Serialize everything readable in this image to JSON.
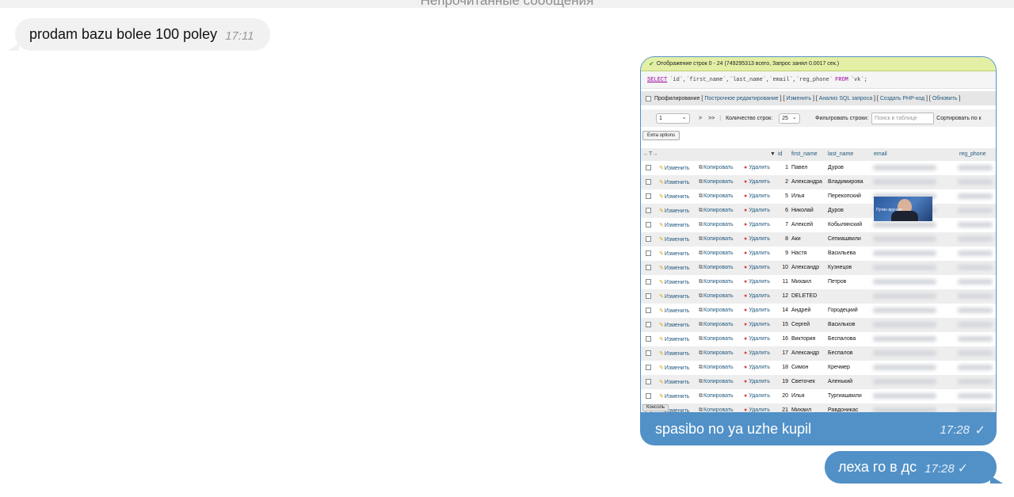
{
  "unread_bar": {
    "label": "Непрочитанные сообщения"
  },
  "messages": [
    {
      "text": "prodam bazu bolee 100 poley",
      "time": "17:11"
    },
    {
      "caption": "spasibo no ya uzhe kupil",
      "time": "17:28",
      "check": "✓"
    },
    {
      "text": "леха го в дс",
      "time": "17:28",
      "check": "✓"
    }
  ],
  "screenshot": {
    "success": "Отображение строк 0 - 24 (749295313 всего, Запрос занял 0.0017 сек.)",
    "sql_select": "SELECT",
    "sql_columns": "`id`,`first_name`,`last_name`,`email`,`reg_phone`",
    "sql_from": "FROM",
    "sql_table": "`vk`;",
    "links": {
      "profiling": "Профилирование",
      "inline_edit": "Построчное редактирование",
      "edit": "Изменить",
      "analyze": "Анализ SQL запроса",
      "create_php": "Создать PHP-код",
      "refresh": "Обновить"
    },
    "nav": {
      "page": "1",
      "next": ">",
      "last": ">>",
      "row_count_label": "Количество строк:",
      "row_count": "25",
      "filter_label": "Фильтровать строки:",
      "filter_placeholder": "Поиск в таблице",
      "sort_label": "Сортировать по к"
    },
    "extra_options": "Extra options",
    "head": {
      "arrows": "←T→",
      "sort": "▼",
      "id": "id",
      "first_name": "first_name",
      "last_name": "last_name",
      "email": "email",
      "reg_phone": "reg_phone"
    },
    "actions": {
      "edit": "Изменить",
      "copy": "Копировать",
      "delete": "Удалить"
    },
    "rows": [
      {
        "id": "1",
        "first_name": "Павел",
        "last_name": "Дуров"
      },
      {
        "id": "2",
        "first_name": "Александра",
        "last_name": "Владимирова"
      },
      {
        "id": "5",
        "first_name": "Илья",
        "last_name": "Перекопский"
      },
      {
        "id": "6",
        "first_name": "Николай",
        "last_name": "Дуров"
      },
      {
        "id": "7",
        "first_name": "Алексей",
        "last_name": "Кобылянский"
      },
      {
        "id": "8",
        "first_name": "Аки",
        "last_name": "Сепиашвили"
      },
      {
        "id": "9",
        "first_name": "Настя",
        "last_name": "Васильева"
      },
      {
        "id": "10",
        "first_name": "Александр",
        "last_name": "Кузнецов"
      },
      {
        "id": "11",
        "first_name": "Михаил",
        "last_name": "Петров"
      },
      {
        "id": "12",
        "first_name": "DELETED",
        "last_name": ""
      },
      {
        "id": "14",
        "first_name": "Андрей",
        "last_name": "Городецкий"
      },
      {
        "id": "15",
        "first_name": "Сергей",
        "last_name": "Васильков"
      },
      {
        "id": "16",
        "first_name": "Виктория",
        "last_name": "Беспалова"
      },
      {
        "id": "17",
        "first_name": "Александр",
        "last_name": "Беспалов"
      },
      {
        "id": "18",
        "first_name": "Симон",
        "last_name": "Кречмер"
      },
      {
        "id": "19",
        "first_name": "Светочек",
        "last_name": "Аленький"
      },
      {
        "id": "20",
        "first_name": "Илья",
        "last_name": "Тургиашвили"
      },
      {
        "id": "21",
        "first_name": "Михаил",
        "last_name": "Равдоникас"
      }
    ],
    "console": "Консоль",
    "thumb_label": "Путин вручает"
  },
  "colors": {
    "outgoing": "#5291c7",
    "incoming": "#f1f1f2",
    "link": "#235a81",
    "success": "#e3efa4"
  }
}
